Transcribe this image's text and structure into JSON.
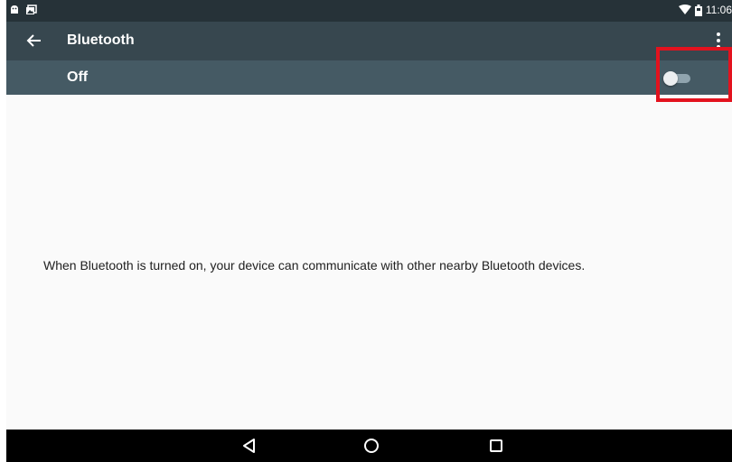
{
  "status_bar": {
    "time": "11:06",
    "left_icons": [
      "android-notification-icon",
      "gallery-notification-icon"
    ],
    "right_icons": [
      "wifi-icon",
      "battery-icon"
    ]
  },
  "app_bar": {
    "title": "Bluetooth",
    "back_icon": "arrow-back-icon",
    "more_icon": "more-vert-icon"
  },
  "switch_bar": {
    "label": "Off",
    "state": "off"
  },
  "content": {
    "message": "When Bluetooth is turned on, your device can communicate with other nearby Bluetooth devices."
  },
  "nav_bar": {
    "buttons": [
      "back-triangle-icon",
      "home-circle-icon",
      "recents-square-icon"
    ]
  },
  "colors": {
    "status_bar": "#263238",
    "app_bar": "#37474f",
    "switch_bar": "#455a64",
    "background": "#fafafa",
    "highlight": "#e3121e"
  }
}
